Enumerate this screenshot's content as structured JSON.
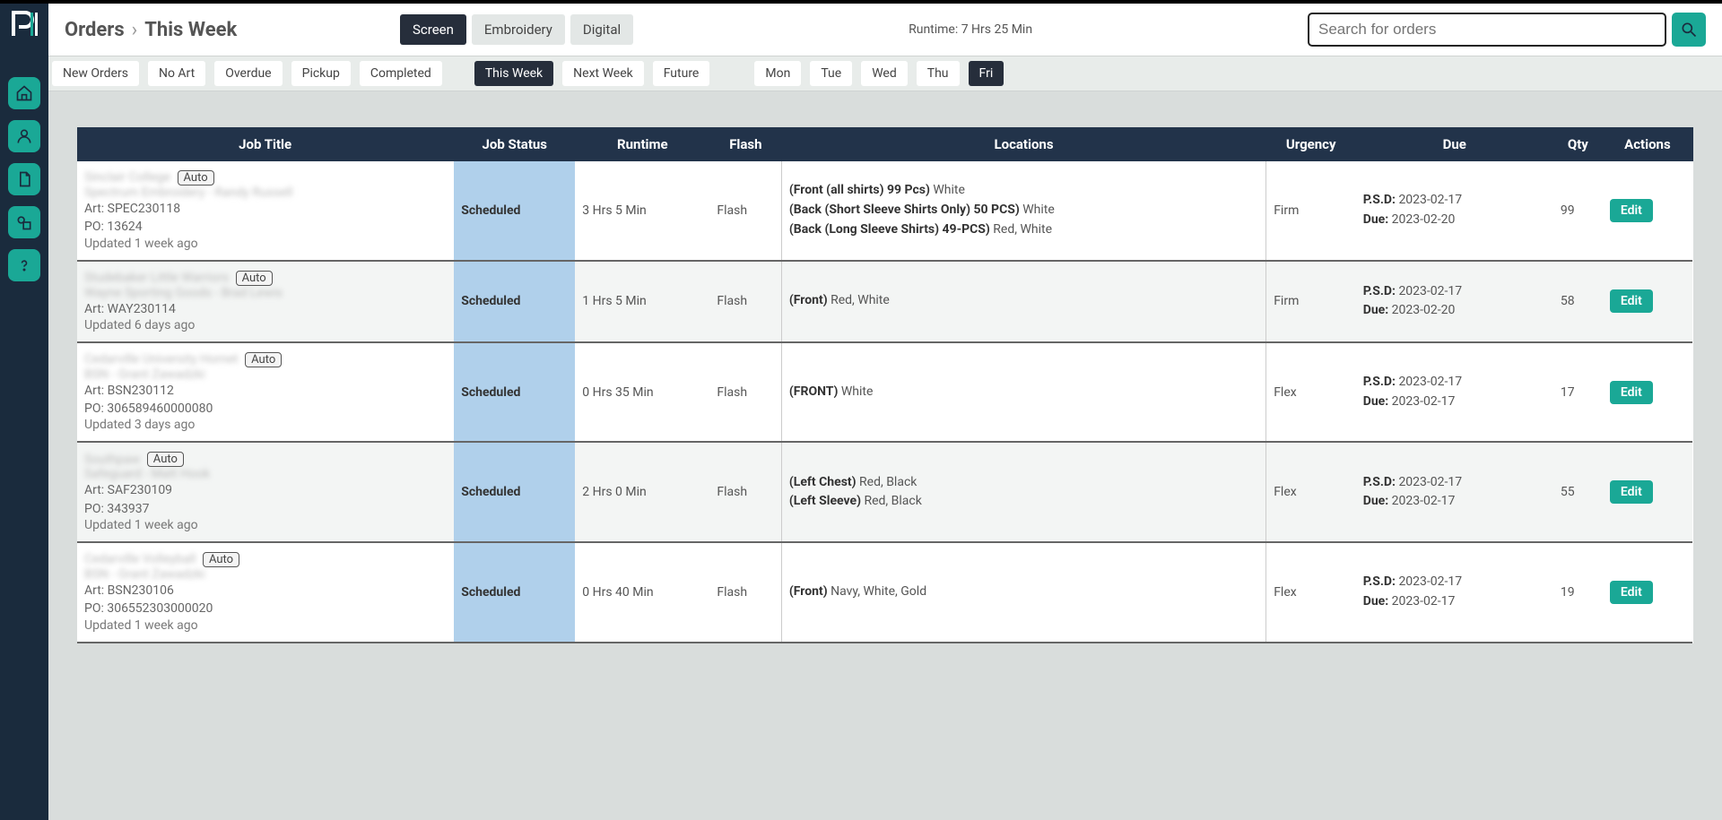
{
  "breadcrumb": {
    "root": "Orders",
    "current": "This Week"
  },
  "runtime_label": "Runtime: 7 Hrs 25 Min",
  "search": {
    "placeholder": "Search for orders"
  },
  "type_tabs": [
    {
      "label": "Screen",
      "active": true
    },
    {
      "label": "Embroidery",
      "active": false
    },
    {
      "label": "Digital",
      "active": false
    }
  ],
  "status_filters": [
    "New Orders",
    "No Art",
    "Overdue",
    "Pickup",
    "Completed"
  ],
  "week_filters": [
    {
      "label": "This Week",
      "active": true
    },
    {
      "label": "Next Week",
      "active": false
    },
    {
      "label": "Future",
      "active": false
    }
  ],
  "day_filters": [
    {
      "label": "Mon",
      "active": false
    },
    {
      "label": "Tue",
      "active": false
    },
    {
      "label": "Wed",
      "active": false
    },
    {
      "label": "Thu",
      "active": false
    },
    {
      "label": "Fri",
      "active": true
    }
  ],
  "columns": [
    "Job Title",
    "Job Status",
    "Runtime",
    "Flash",
    "Locations",
    "Urgency",
    "Due",
    "Qty",
    "Actions"
  ],
  "auto_label": "Auto",
  "psd_label": "P.S.D:",
  "due_label": "Due:",
  "edit_label": "Edit",
  "rows": [
    {
      "title_blur": "Sinclair College",
      "auto": true,
      "sub_blur": "Spectrum Embroidery - Randy Russell",
      "meta": [
        "Art: SPEC230118",
        "PO: 13624"
      ],
      "updated": "Updated 1 week ago",
      "status": "Scheduled",
      "runtime": "3 Hrs 5 Min",
      "flash": "Flash",
      "locations": [
        {
          "bold": "(Front (all shirts) 99 Pcs)",
          "rest": " White"
        },
        {
          "bold": "(Back (Short Sleeve Shirts Only) 50 PCS)",
          "rest": " White"
        },
        {
          "bold": "(Back (Long Sleeve Shirts) 49-PCS)",
          "rest": " Red, White"
        }
      ],
      "urgency": "Firm",
      "psd": "2023-02-17",
      "due": "2023-02-20",
      "qty": "99"
    },
    {
      "title_blur": "Studebaker Little Warriors",
      "auto": true,
      "sub_blur": "Wayne Sporting Goods - Brad Lewis",
      "meta": [
        "Art: WAY230114"
      ],
      "updated": "Updated 6 days ago",
      "status": "Scheduled",
      "runtime": "1 Hrs 5 Min",
      "flash": "Flash",
      "locations": [
        {
          "bold": "(Front)",
          "rest": " Red, White"
        }
      ],
      "urgency": "Firm",
      "psd": "2023-02-17",
      "due": "2023-02-20",
      "qty": "58"
    },
    {
      "title_blur": "Cedarville University Hornet",
      "auto": true,
      "sub_blur": "BSN - Grant Zawadzki",
      "meta": [
        "Art: BSN230112",
        "PO: 306589460000080"
      ],
      "updated": "Updated 3 days ago",
      "status": "Scheduled",
      "runtime": "0 Hrs 35 Min",
      "flash": "Flash",
      "locations": [
        {
          "bold": "(FRONT)",
          "rest": " White"
        }
      ],
      "urgency": "Flex",
      "psd": "2023-02-17",
      "due": "2023-02-17",
      "qty": "17"
    },
    {
      "title_blur": "Southpaw",
      "auto": true,
      "sub_blur": "Safeguard - Matt Hook",
      "meta": [
        "Art: SAF230109",
        "PO: 343937"
      ],
      "updated": "Updated 1 week ago",
      "status": "Scheduled",
      "runtime": "2 Hrs 0 Min",
      "flash": "Flash",
      "locations": [
        {
          "bold": "(Left Chest)",
          "rest": " Red, Black"
        },
        {
          "bold": "(Left Sleeve)",
          "rest": " Red, Black"
        }
      ],
      "urgency": "Flex",
      "psd": "2023-02-17",
      "due": "2023-02-17",
      "qty": "55"
    },
    {
      "title_blur": "Cedarville Volleyball",
      "auto": true,
      "sub_blur": "BSN - Grant Zawadzki",
      "meta": [
        "Art: BSN230106",
        "PO: 306552303000020"
      ],
      "updated": "Updated 1 week ago",
      "status": "Scheduled",
      "runtime": "0 Hrs 40 Min",
      "flash": "Flash",
      "locations": [
        {
          "bold": "(Front)",
          "rest": " Navy, White, Gold"
        }
      ],
      "urgency": "Flex",
      "psd": "2023-02-17",
      "due": "2023-02-17",
      "qty": "19"
    }
  ]
}
